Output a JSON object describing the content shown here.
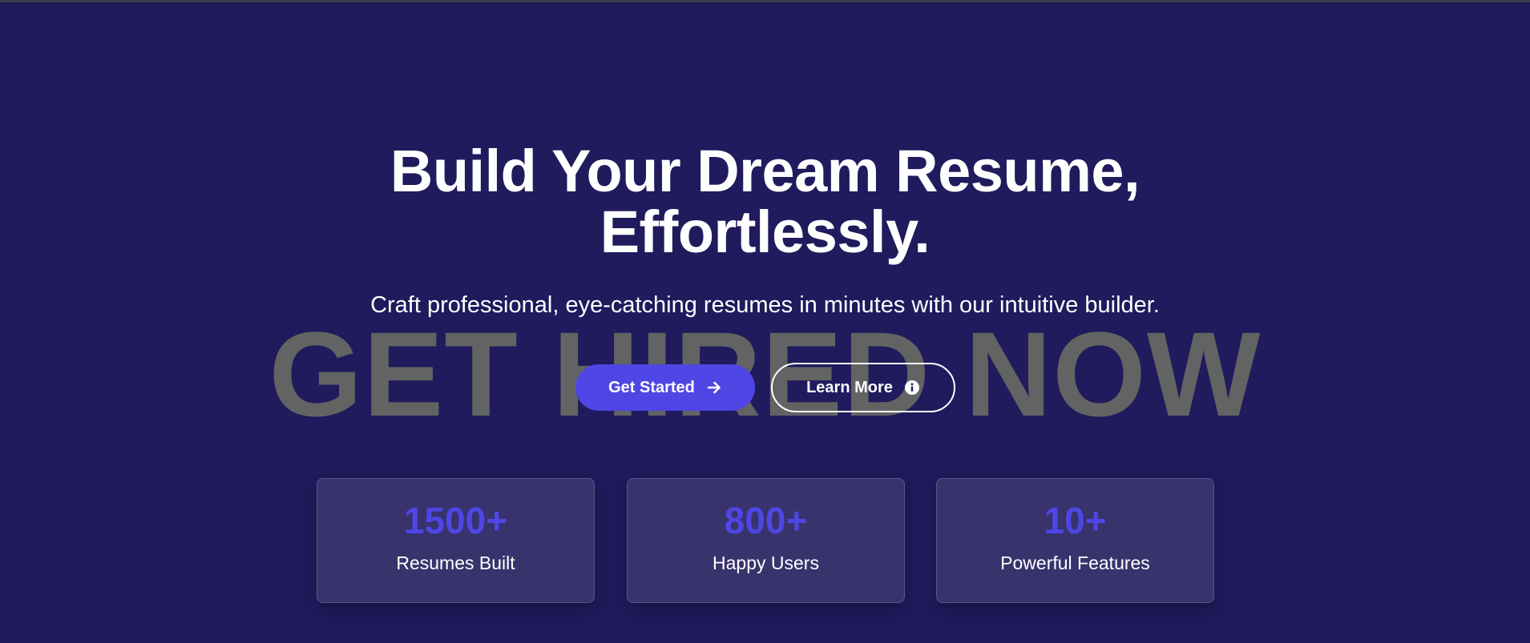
{
  "hero": {
    "title_line1": "Build Your Dream Resume,",
    "title_line2": "Effortlessly.",
    "subtitle": "Craft professional, eye-catching resumes in minutes with our intuitive builder.",
    "watermark": "GET HIRED NOW"
  },
  "buttons": {
    "primary_label": "Get Started",
    "primary_icon": "arrow-right-icon",
    "secondary_label": "Learn More",
    "secondary_icon": "info-circle-icon"
  },
  "stats": [
    {
      "value": "1500+",
      "label": "Resumes Built"
    },
    {
      "value": "800+",
      "label": "Happy Users"
    },
    {
      "value": "10+",
      "label": "Powerful Features"
    }
  ],
  "colors": {
    "background": "#1f1b5c",
    "accent": "#4f46e5",
    "card": "#38336d",
    "watermark": "#636363",
    "text": "#ffffff"
  }
}
